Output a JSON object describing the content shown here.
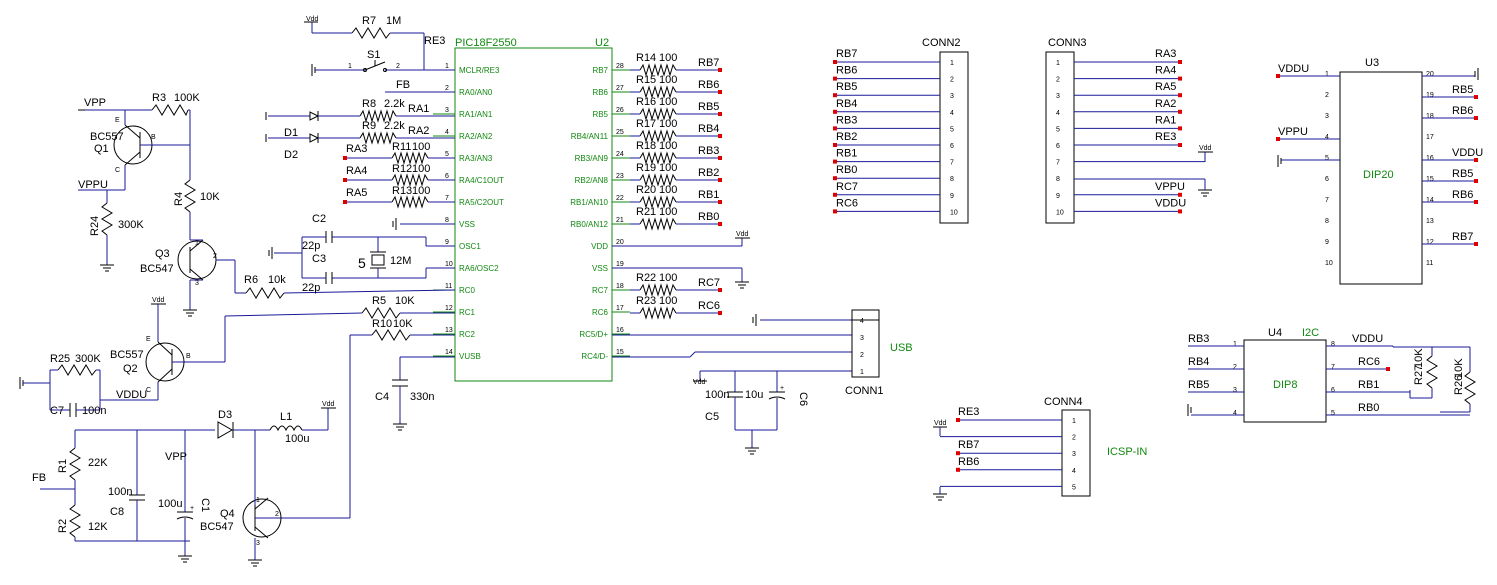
{
  "u2": {
    "part": "PIC18F2550",
    "ref": "U2",
    "left_pins": [
      {
        "num": "1",
        "name": "MCLR/RE3"
      },
      {
        "num": "2",
        "name": "RA0/AN0"
      },
      {
        "num": "3",
        "name": "RA1/AN1"
      },
      {
        "num": "4",
        "name": "RA2/AN2"
      },
      {
        "num": "5",
        "name": "RA3/AN3"
      },
      {
        "num": "6",
        "name": "RA4/C1OUT"
      },
      {
        "num": "7",
        "name": "RA5/C2OUT"
      },
      {
        "num": "8",
        "name": "VSS"
      },
      {
        "num": "9",
        "name": "OSC1"
      },
      {
        "num": "10",
        "name": "RA6/OSC2"
      },
      {
        "num": "11",
        "name": "RC0"
      },
      {
        "num": "12",
        "name": "RC1"
      },
      {
        "num": "13",
        "name": "RC2"
      },
      {
        "num": "14",
        "name": "VUSB"
      }
    ],
    "right_pins": [
      {
        "num": "28",
        "name": "RB7"
      },
      {
        "num": "27",
        "name": "RB6"
      },
      {
        "num": "26",
        "name": "RB5"
      },
      {
        "num": "25",
        "name": "RB4/AN11"
      },
      {
        "num": "24",
        "name": "RB3/AN9"
      },
      {
        "num": "23",
        "name": "RB2/AN8"
      },
      {
        "num": "22",
        "name": "RB1/AN10"
      },
      {
        "num": "21",
        "name": "RB0/AN12"
      },
      {
        "num": "20",
        "name": "VDD"
      },
      {
        "num": "19",
        "name": "VSS"
      },
      {
        "num": "18",
        "name": "RC7"
      },
      {
        "num": "17",
        "name": "RC6"
      },
      {
        "num": "16",
        "name": "RC5/D+"
      },
      {
        "num": "15",
        "name": "RC4/D-"
      }
    ]
  },
  "u2_right_resistors": [
    {
      "ref": "R14",
      "val": "100",
      "net": "RB7"
    },
    {
      "ref": "R15",
      "val": "100",
      "net": "RB6"
    },
    {
      "ref": "R16",
      "val": "100",
      "net": "RB5"
    },
    {
      "ref": "R17",
      "val": "100",
      "net": "RB4"
    },
    {
      "ref": "R18",
      "val": "100",
      "net": "RB3"
    },
    {
      "ref": "R19",
      "val": "100",
      "net": "RB2"
    },
    {
      "ref": "R20",
      "val": "100",
      "net": "RB1"
    },
    {
      "ref": "R21",
      "val": "100",
      "net": "RB0"
    },
    {
      "ref": "R22",
      "val": "100",
      "net": "RC7"
    },
    {
      "ref": "R23",
      "val": "100",
      "net": "RC6"
    }
  ],
  "u2_left_resistors": [
    {
      "ref": "R8",
      "val": "2.2k",
      "net": "RA1"
    },
    {
      "ref": "R9",
      "val": "2.2k",
      "net": "RA2"
    },
    {
      "ref": "R11",
      "val": "100",
      "net": "RA3"
    },
    {
      "ref": "R12",
      "val": "100",
      "net": "RA4"
    },
    {
      "ref": "R13",
      "val": "100",
      "net": "RA5"
    }
  ],
  "labels": {
    "vdd": "Vdd",
    "r7": "R7",
    "r7v": "1M",
    "re3": "RE3",
    "s1": "S1",
    "s1p1": "1",
    "s1p2": "2",
    "fb": "FB",
    "d1": "D1",
    "d2": "D2",
    "vpp": "VPP",
    "vppu": "VPPU",
    "vddu": "VDDU",
    "r3": "R3",
    "r3v": "100K",
    "q1": "Q1",
    "q1t": "BC557",
    "r24": "R24",
    "r24v": "300K",
    "r4": "R4",
    "r4v": "10K",
    "q3": "Q3",
    "q3t": "BC547",
    "c2": "C2",
    "c2v": "22p",
    "c3": "C3",
    "c3v": "22p",
    "xtal": "5",
    "xtalv": "12M",
    "r6": "R6",
    "r6v": "10k",
    "r5": "R5",
    "r5v": "10K",
    "r10": "R10",
    "r10v": "10K",
    "q2": "Q2",
    "q2t": "BC557",
    "r25": "R25",
    "r25v": "300K",
    "c7": "C7",
    "c7v": "100n",
    "c4": "C4",
    "c4v": "330n",
    "d3": "D3",
    "l1": "L1",
    "l1v": "100u",
    "r1": "R1",
    "r1v": "22K",
    "r2": "R2",
    "r2v": "12K",
    "c8": "C8",
    "c8v": "100n",
    "c1": "C1",
    "c1v": "100u",
    "q4": "Q4",
    "q4t": "BC547",
    "c5": "C5",
    "c5v": "100n",
    "c6": "C6",
    "c6v": "10u",
    "usb": "USB",
    "conn1": "CONN1",
    "conn2": "CONN2",
    "conn3": "CONN3",
    "conn4": "CONN4",
    "icsp": "ICSP-IN",
    "u3": "U3",
    "dip20": "DIP20",
    "u4": "U4",
    "i2c": "I2C",
    "dip8": "DIP8",
    "r27": "R27",
    "r27v": "10K",
    "r26": "R26",
    "r26v": "10K"
  },
  "conn2_nets": [
    "RB7",
    "RB6",
    "RB5",
    "RB4",
    "RB3",
    "RB2",
    "RB1",
    "RB0",
    "RC7",
    "RC6"
  ],
  "conn3_nets": [
    "RA3",
    "RA4",
    "RA5",
    "RA2",
    "RA1",
    "RE3",
    "Vdd",
    "",
    "VPPU",
    "VDDU"
  ],
  "conn4_nets": [
    "RE3",
    "Vdd",
    "RB7",
    "RB6",
    ""
  ],
  "u3_left_nets": [
    "VDDU",
    "",
    "",
    "VPPU",
    "",
    "",
    "",
    "",
    "",
    ""
  ],
  "u3_right_nets": [
    "",
    "RB5",
    "RB6",
    "",
    "VDDU",
    "RB5",
    "RB6",
    "",
    "RB7",
    ""
  ],
  "u4_left_nets": [
    "RB3",
    "RB4",
    "RB5",
    ""
  ],
  "u4_right_nets": [
    "VDDU",
    "RC6",
    "RB1",
    "RB0"
  ],
  "colors": {
    "wire": "#1a1a9a",
    "part": "#000000",
    "pin_name": "#118811",
    "terminal": "#e00000"
  }
}
